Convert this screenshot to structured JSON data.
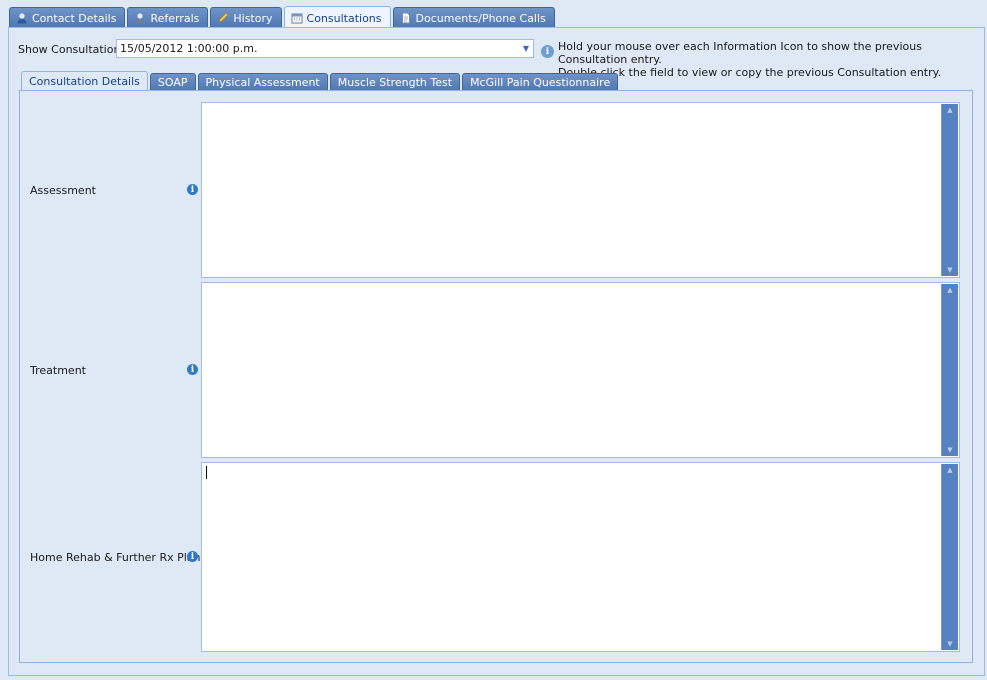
{
  "top_tabs": [
    {
      "label": "Contact Details",
      "icon": "contact-icon"
    },
    {
      "label": "Referrals",
      "icon": "referral-icon"
    },
    {
      "label": "History",
      "icon": "pencil-icon"
    },
    {
      "label": "Consultations",
      "icon": "calendar-icon",
      "active": true
    },
    {
      "label": "Documents/Phone Calls",
      "icon": "document-icon"
    }
  ],
  "show_consultation": {
    "label": "Show Consultation:",
    "value": "15/05/2012 1:00:00 p.m."
  },
  "hint": {
    "line1": "Hold your mouse over each Information Icon to show the previous Consultation entry.",
    "line2": "Double click the field to view or copy the previous Consultation entry."
  },
  "inner_tabs": [
    {
      "label": "Consultation Details",
      "active": true
    },
    {
      "label": "SOAP"
    },
    {
      "label": "Physical Assessment"
    },
    {
      "label": "Muscle Strength Test"
    },
    {
      "label": "McGill Pain Questionnaire"
    }
  ],
  "fields": {
    "assessment": {
      "label": "Assessment",
      "value": ""
    },
    "treatment": {
      "label": "Treatment",
      "value": ""
    },
    "home_rehab": {
      "label": "Home Rehab & Further Rx Plan",
      "value": ""
    }
  },
  "colors": {
    "background": "#dfe9f6",
    "tab_blue": "#4f77b3",
    "info_icon": "#2f79c5",
    "scrollbar": "#5581c1"
  }
}
